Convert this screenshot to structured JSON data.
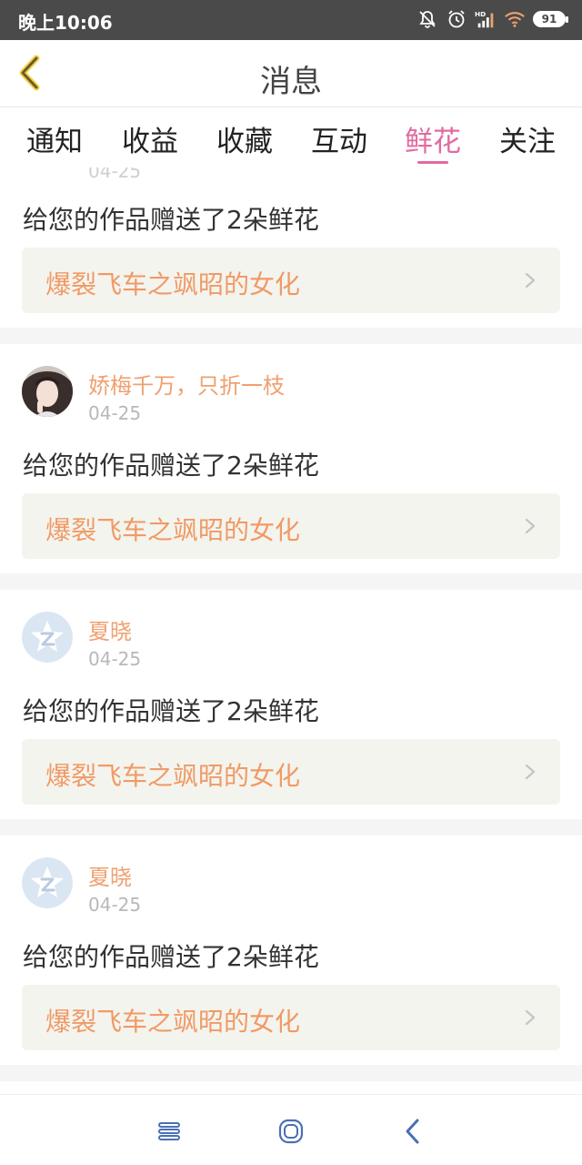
{
  "status_bar": {
    "time": "晚上10:06",
    "battery": "91",
    "icons": [
      "bell-muted-icon",
      "alarm-icon",
      "hd-signal-icon",
      "wifi-icon",
      "battery-icon"
    ]
  },
  "header": {
    "title": "消息",
    "back_icon": "chevron-left-icon"
  },
  "tabs": [
    {
      "label": "通知",
      "active": false
    },
    {
      "label": "收益",
      "active": false
    },
    {
      "label": "收藏",
      "active": false
    },
    {
      "label": "互动",
      "active": false
    },
    {
      "label": "鲜花",
      "active": true
    },
    {
      "label": "关注",
      "active": false
    }
  ],
  "messages": [
    {
      "partial_date": "04-25",
      "message": "给您的作品赠送了2朵鲜花",
      "work_title": "爆裂飞车之飒昭的女化"
    },
    {
      "username": "娇梅千万，只折一枝",
      "date": "04-25",
      "avatar": "photo-avatar",
      "message": "给您的作品赠送了2朵鲜花",
      "work_title": "爆裂飞车之飒昭的女化"
    },
    {
      "username": "夏晓",
      "date": "04-25",
      "avatar": "default-star-avatar",
      "message": "给您的作品赠送了2朵鲜花",
      "work_title": "爆裂飞车之飒昭的女化"
    },
    {
      "username": "夏晓",
      "date": "04-25",
      "avatar": "default-star-avatar",
      "message": "给您的作品赠送了2朵鲜花",
      "work_title": "爆裂飞车之飒昭的女化"
    }
  ],
  "nav_bar": {
    "buttons": [
      "menu-icon",
      "home-icon",
      "back-icon"
    ]
  },
  "colors": {
    "accent_pink": "#e26aa0",
    "username_orange": "#f0a070",
    "work_title_orange": "#f09a66",
    "status_bar_bg": "#4a4a4a"
  }
}
